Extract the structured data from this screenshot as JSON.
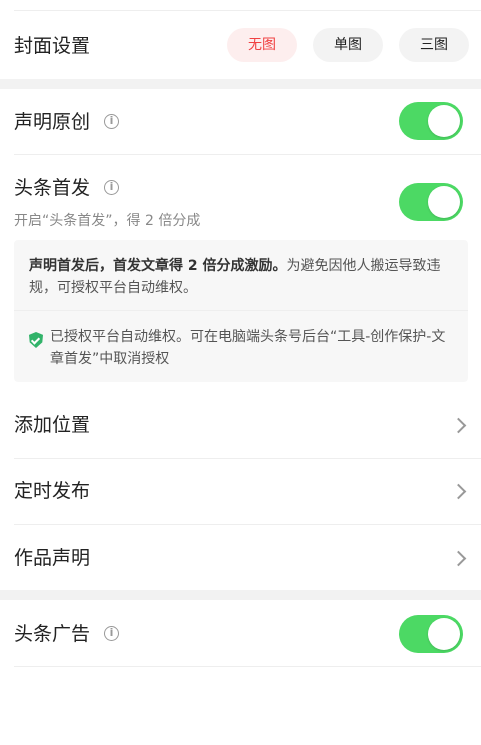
{
  "cover": {
    "title": "封面设置",
    "options": [
      "无图",
      "单图",
      "三图"
    ],
    "selected": "无图"
  },
  "original": {
    "title": "声明原创",
    "enabled": true
  },
  "headline_first": {
    "title": "头条首发",
    "subtitle": "开启“头条首发”，得 2 倍分成",
    "enabled": true
  },
  "notice": {
    "bold_text": "声明首发后，首发文章得 2 倍分成激励。",
    "text": "为避免因他人搬运导致违规，可授权平台自动维权。",
    "auth_text": "已授权平台自动维权。可在电脑端头条号后台“工具-创作保护-文章首发”中取消授权"
  },
  "rows": [
    {
      "label": "添加位置"
    },
    {
      "label": "定时发布"
    },
    {
      "label": "作品声明"
    }
  ],
  "ads": {
    "title": "头条广告",
    "enabled": true
  },
  "colors": {
    "accent": "#f04142",
    "toggle_on": "#4cd964",
    "shield": "#32b36a"
  },
  "icons": {
    "info": "info-circle-icon",
    "chevron": "chevron-right-icon",
    "shield": "shield-check-icon"
  }
}
